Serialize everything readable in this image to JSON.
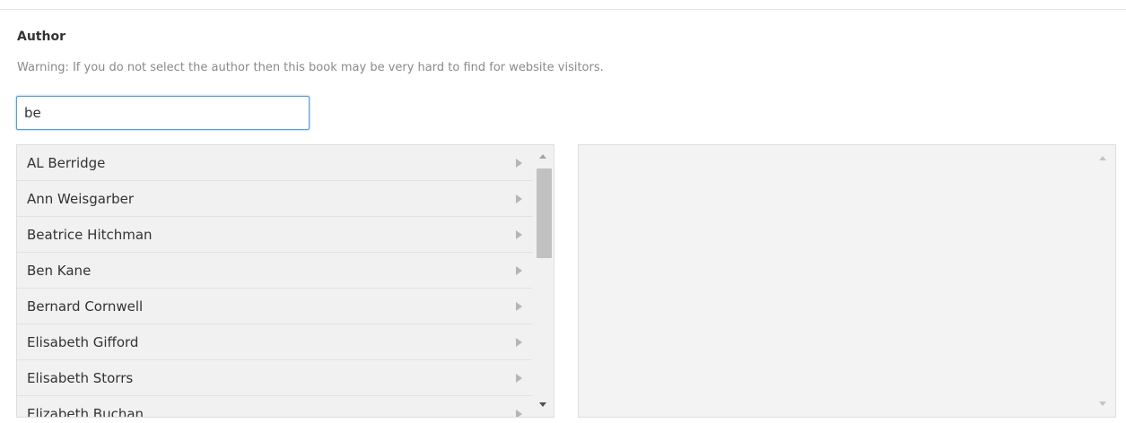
{
  "field": {
    "label": "Author",
    "warning": "Warning: If you do not select the author then this book may be very hard to find for website visitors."
  },
  "search": {
    "value": "be"
  },
  "available_authors": [
    {
      "label": "AL Berridge"
    },
    {
      "label": "Ann Weisgarber"
    },
    {
      "label": "Beatrice Hitchman"
    },
    {
      "label": "Ben Kane"
    },
    {
      "label": "Bernard Cornwell"
    },
    {
      "label": "Elisabeth Gifford"
    },
    {
      "label": "Elisabeth Storrs"
    },
    {
      "label": "Elizabeth Buchan"
    }
  ],
  "selected_authors": [],
  "icons": {
    "item": "chevron-right-icon",
    "scroll_up": "scroll-up-icon",
    "scroll_down": "scroll-down-icon"
  },
  "colors": {
    "focus_border": "#5b9dd9",
    "panel_bg": "#f1f1f1",
    "warning_text": "#8a8a8a"
  }
}
